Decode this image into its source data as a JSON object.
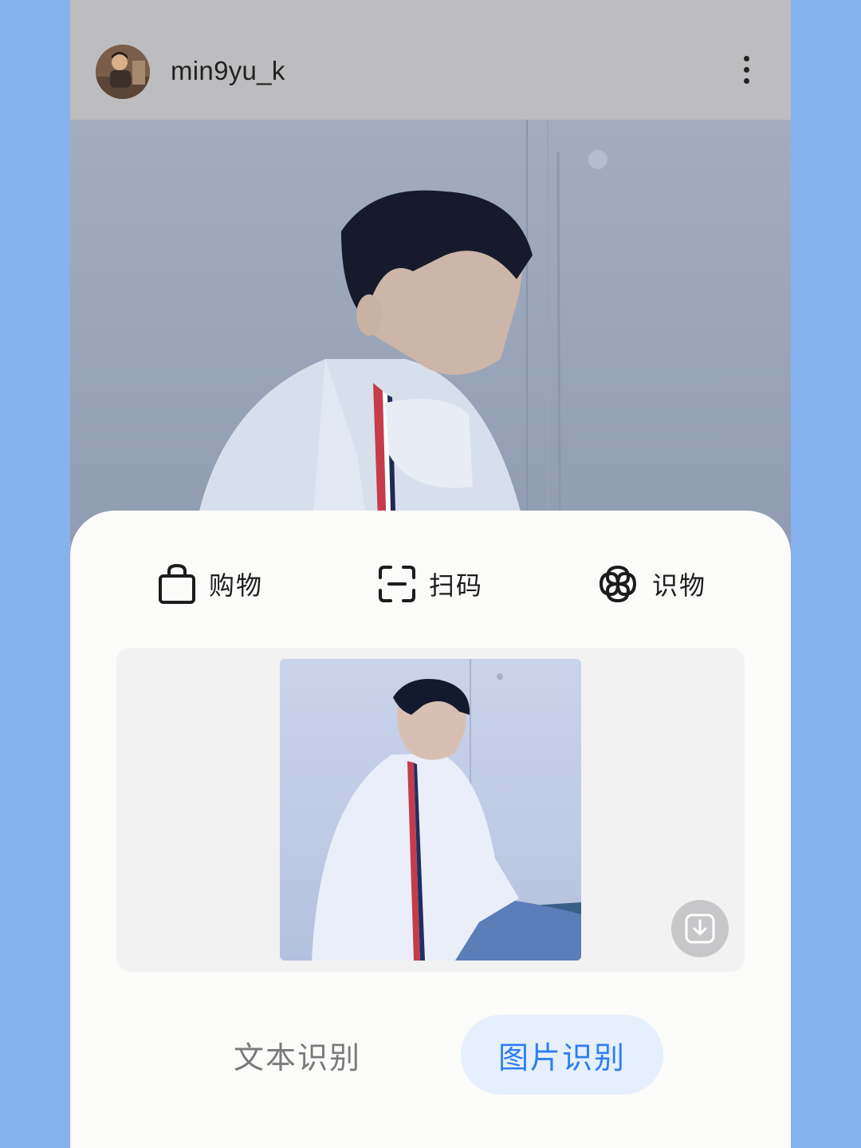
{
  "header": {
    "username": "min9yu_k",
    "avatar_icon": "avatar",
    "more_icon": "more-vertical-icon"
  },
  "tools": [
    {
      "label": "购物",
      "icon": "shopping-bag-icon"
    },
    {
      "label": "扫码",
      "icon": "scan-icon"
    },
    {
      "label": "识物",
      "icon": "object-recognition-icon"
    }
  ],
  "preview": {
    "download_icon": "download-icon"
  },
  "tabs": {
    "text_recognition": "文本识别",
    "image_recognition": "图片识别"
  },
  "colors": {
    "background": "#86b3f0",
    "active_tab_text": "#2f7ef0",
    "active_tab_bg": "#e6effc",
    "inactive_tab_text": "#7a7a7a"
  }
}
